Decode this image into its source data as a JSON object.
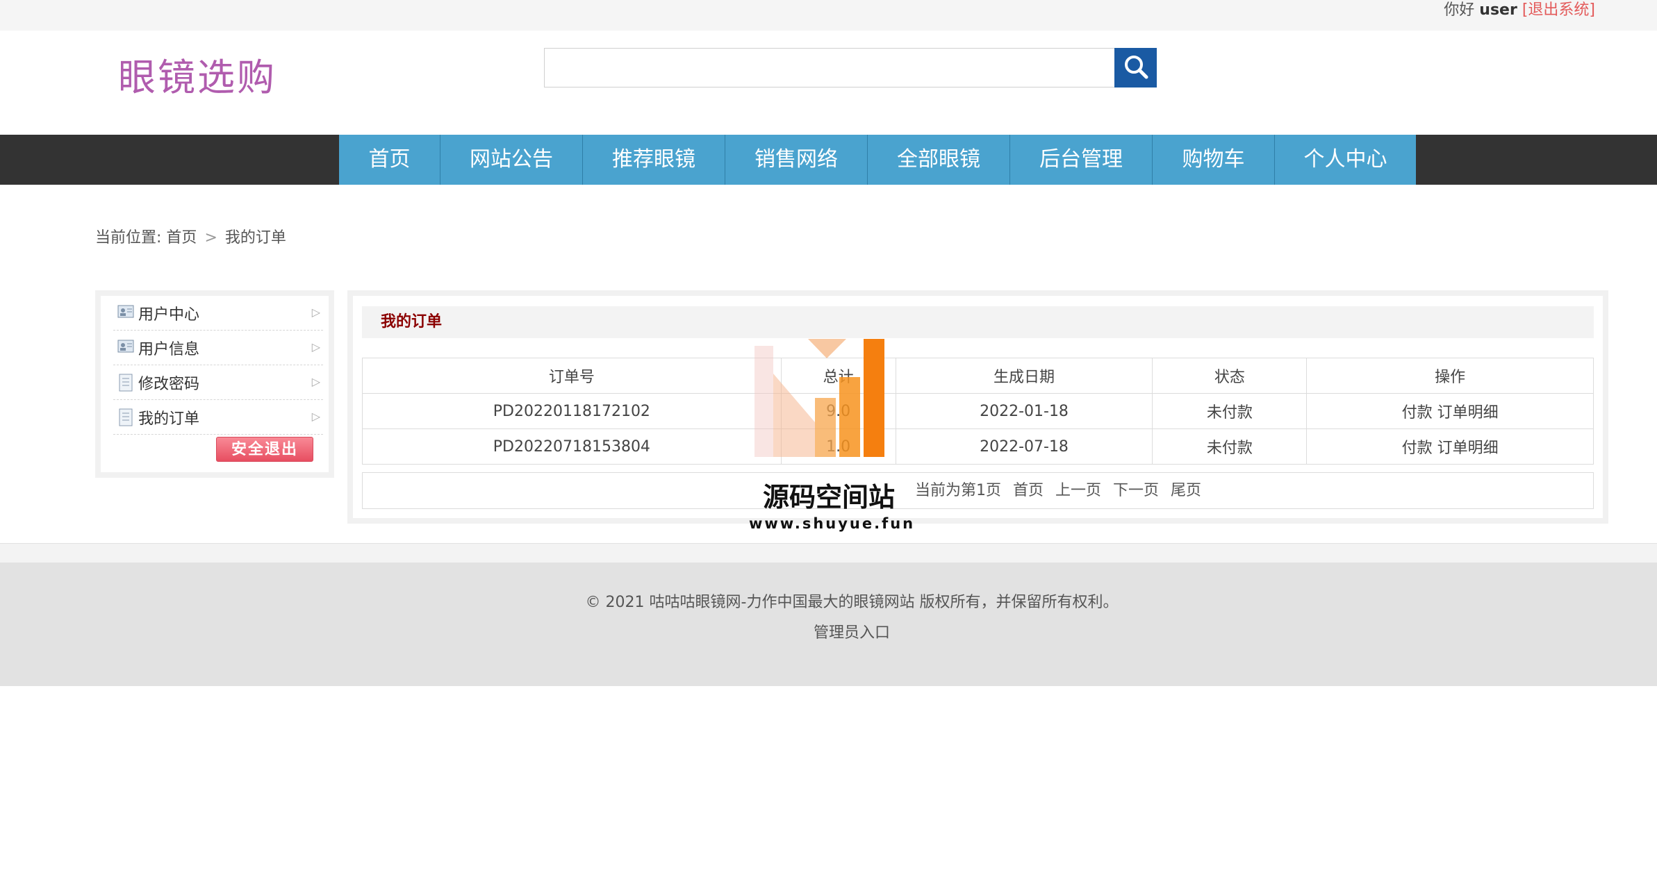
{
  "topbar": {
    "greeting": "你好",
    "username": "user",
    "logout_link": "[退出系统]"
  },
  "header": {
    "logo_text": "眼镜选购",
    "search_placeholder": "",
    "search_icon": "search-icon"
  },
  "nav": {
    "items": [
      {
        "label": "首页"
      },
      {
        "label": "网站公告"
      },
      {
        "label": "推荐眼镜"
      },
      {
        "label": "销售网络"
      },
      {
        "label": "全部眼镜"
      },
      {
        "label": "后台管理"
      },
      {
        "label": "购物车"
      },
      {
        "label": "个人中心"
      }
    ]
  },
  "breadcrumb": {
    "prefix": "当前位置:",
    "home": "首页",
    "separator": ">",
    "current": "我的订单"
  },
  "sidebar": {
    "items": [
      {
        "label": "用户中心",
        "icon": "user-card-icon"
      },
      {
        "label": "用户信息",
        "icon": "user-card-icon"
      },
      {
        "label": "修改密码",
        "icon": "document-icon"
      },
      {
        "label": "我的订单",
        "icon": "document-icon"
      }
    ],
    "logout_button": "安全退出"
  },
  "main": {
    "title": "我的订单",
    "table": {
      "headers": [
        "订单号",
        "总计",
        "生成日期",
        "状态",
        "操作"
      ],
      "rows": [
        {
          "order_no": "PD20220118172102",
          "total": "9.0",
          "date": "2022-01-18",
          "status": "未付款",
          "pay": "付款",
          "detail": "订单明细"
        },
        {
          "order_no": "PD20220718153804",
          "total": "1.0",
          "date": "2022-07-18",
          "status": "未付款",
          "pay": "付款",
          "detail": "订单明细"
        }
      ]
    },
    "pager": {
      "current": "当前为第1页",
      "first": "首页",
      "prev": "上一页",
      "next": "下一页",
      "last": "尾页"
    }
  },
  "footer": {
    "copyright": "© 2021 咕咕咕眼镜网-力作中国最大的眼镜网站 版权所有，并保留所有权利。",
    "admin_link": "管理员入口"
  },
  "watermark": {
    "title": "源码空间站",
    "url": "www.shuyue.fun"
  },
  "colors": {
    "nav_bg": "#4aa3cf",
    "navbar_dark": "#333333",
    "logo": "#b05cae",
    "search_button": "#1a5aa3",
    "title_red": "#8b0000",
    "logout_link": "#e35a5a",
    "watermark_orange": "#f7931e"
  }
}
